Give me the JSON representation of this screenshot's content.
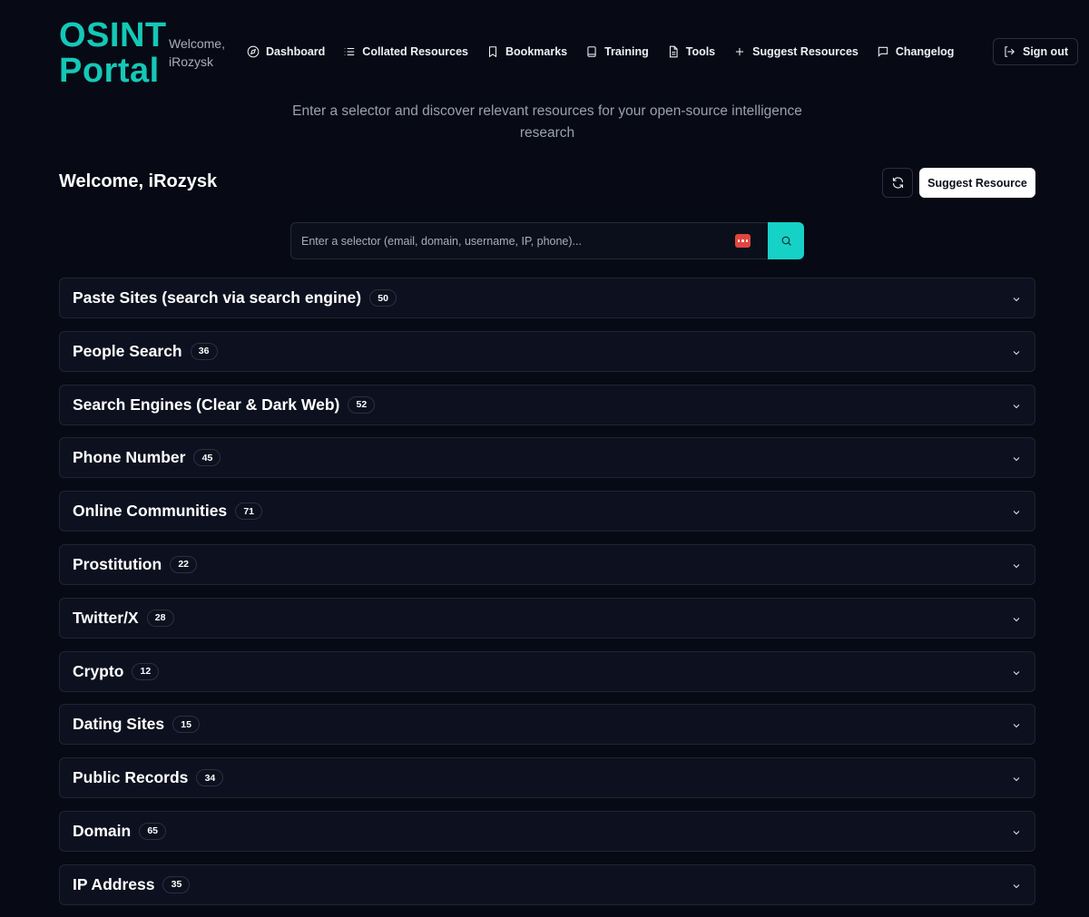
{
  "brand": {
    "line1": "OSINT",
    "line2": "Portal",
    "welcome_small": "Welcome, iRozysk"
  },
  "nav": [
    {
      "label": "Dashboard",
      "icon": "compass-icon"
    },
    {
      "label": "Collated Resources",
      "icon": "list-icon"
    },
    {
      "label": "Bookmarks",
      "icon": "bookmark-icon"
    },
    {
      "label": "Training",
      "icon": "book-icon"
    },
    {
      "label": "Tools",
      "icon": "document-icon"
    },
    {
      "label": "Suggest Resources",
      "icon": "plus-icon"
    },
    {
      "label": "Changelog",
      "icon": "message-icon"
    }
  ],
  "signout_label": "Sign out",
  "tagline": "Enter a selector and discover relevant resources for your open-source intelligence research",
  "welcome_title": "Welcome, iRozysk",
  "suggest_button": "Suggest Resource",
  "search": {
    "placeholder": "Enter a selector (email, domain, username, IP, phone)...",
    "value": ""
  },
  "categories": [
    {
      "title": "Paste Sites (search via search engine)",
      "count": "50"
    },
    {
      "title": "People Search",
      "count": "36"
    },
    {
      "title": "Search Engines (Clear & Dark Web)",
      "count": "52"
    },
    {
      "title": "Phone Number",
      "count": "45"
    },
    {
      "title": "Online Communities",
      "count": "71"
    },
    {
      "title": "Prostitution",
      "count": "22"
    },
    {
      "title": "Twitter/X",
      "count": "28"
    },
    {
      "title": "Crypto",
      "count": "12"
    },
    {
      "title": "Dating Sites",
      "count": "15"
    },
    {
      "title": "Public Records",
      "count": "34"
    },
    {
      "title": "Domain",
      "count": "65"
    },
    {
      "title": "IP Address",
      "count": "35"
    }
  ],
  "colors": {
    "background": "#070a14",
    "accent": "#14c8b8",
    "card": "#0d111f"
  }
}
